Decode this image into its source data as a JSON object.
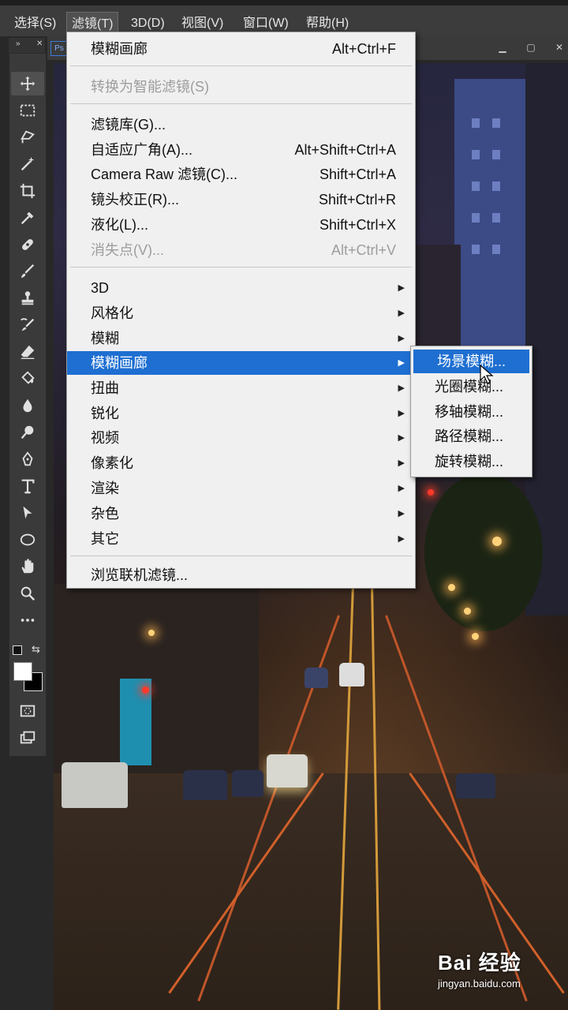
{
  "menubar": {
    "items": [
      {
        "label": "选择(S)"
      },
      {
        "label": "滤镜(T)"
      },
      {
        "label": "3D(D)"
      },
      {
        "label": "视图(V)"
      },
      {
        "label": "窗口(W)"
      },
      {
        "label": "帮助(H)"
      }
    ],
    "active_item": "滤镜(T)"
  },
  "doc_tab": {
    "badge": "Ps"
  },
  "filter_menu": {
    "recent": {
      "label": "模糊画廊",
      "shortcut": "Alt+Ctrl+F"
    },
    "smart": {
      "label": "转换为智能滤镜(S)"
    },
    "group2": [
      {
        "label": "滤镜库(G)...",
        "shortcut": ""
      },
      {
        "label": "自适应广角(A)...",
        "shortcut": "Alt+Shift+Ctrl+A"
      },
      {
        "label": "Camera Raw 滤镜(C)...",
        "shortcut": "Shift+Ctrl+A"
      },
      {
        "label": "镜头校正(R)...",
        "shortcut": "Shift+Ctrl+R"
      },
      {
        "label": "液化(L)...",
        "shortcut": "Shift+Ctrl+X"
      },
      {
        "label": "消失点(V)...",
        "shortcut": "Alt+Ctrl+V"
      }
    ],
    "submenus": [
      {
        "label": "3D"
      },
      {
        "label": "风格化"
      },
      {
        "label": "模糊"
      },
      {
        "label": "模糊画廊"
      },
      {
        "label": "扭曲"
      },
      {
        "label": "锐化"
      },
      {
        "label": "视频"
      },
      {
        "label": "像素化"
      },
      {
        "label": "渲染"
      },
      {
        "label": "杂色"
      },
      {
        "label": "其它"
      }
    ],
    "highlighted": "模糊画廊",
    "browse": {
      "label": "浏览联机滤镜..."
    }
  },
  "blur_gallery_submenu": {
    "items": [
      {
        "label": "场景模糊..."
      },
      {
        "label": "光圈模糊..."
      },
      {
        "label": "移轴模糊..."
      },
      {
        "label": "路径模糊..."
      },
      {
        "label": "旋转模糊..."
      }
    ],
    "highlighted": "场景模糊..."
  },
  "tools": [
    {
      "name": "move-tool-icon"
    },
    {
      "name": "marquee-tool-icon"
    },
    {
      "name": "lasso-tool-icon"
    },
    {
      "name": "magic-wand-tool-icon"
    },
    {
      "name": "crop-tool-icon"
    },
    {
      "name": "eyedropper-tool-icon"
    },
    {
      "name": "healing-brush-tool-icon"
    },
    {
      "name": "brush-tool-icon"
    },
    {
      "name": "clone-stamp-tool-icon"
    },
    {
      "name": "history-brush-tool-icon"
    },
    {
      "name": "eraser-tool-icon"
    },
    {
      "name": "paint-bucket-tool-icon"
    },
    {
      "name": "blur-tool-icon"
    },
    {
      "name": "dodge-tool-icon"
    },
    {
      "name": "pen-tool-icon"
    },
    {
      "name": "type-tool-icon"
    },
    {
      "name": "path-selection-tool-icon"
    },
    {
      "name": "ellipse-tool-icon"
    },
    {
      "name": "hand-tool-icon"
    },
    {
      "name": "zoom-tool-icon"
    },
    {
      "name": "more-tools-icon"
    }
  ],
  "colors": {
    "menu_bg": "#f0f0f0",
    "highlight": "#1e6fd1",
    "menubar_bg": "#3c3c3c",
    "toolbar_bg": "#3a3a3a"
  },
  "watermark": {
    "logo": "Bai 经验",
    "url": "jingyan.baidu.com"
  }
}
